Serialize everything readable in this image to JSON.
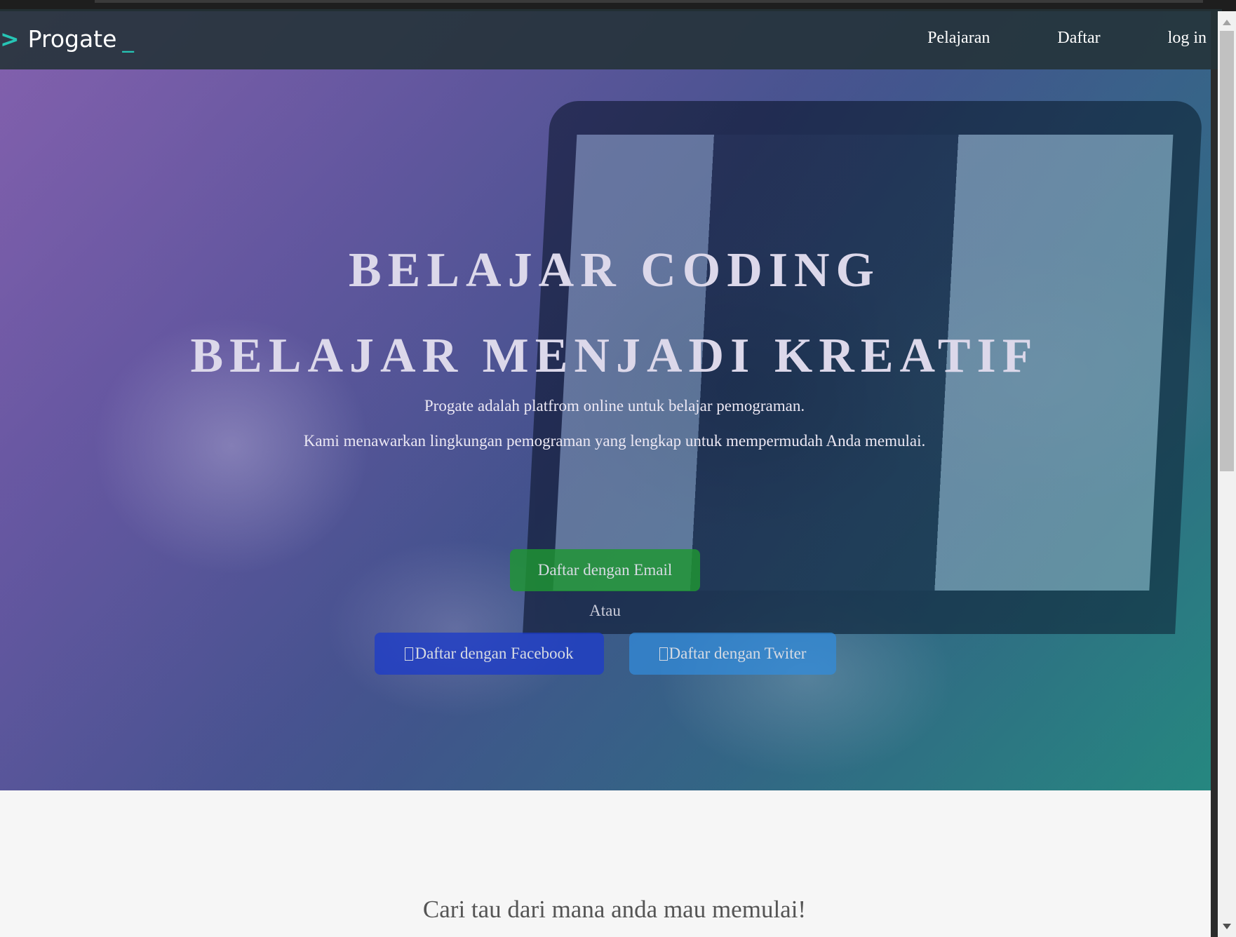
{
  "nav": {
    "brand": "Progate",
    "brand_prompt": ">",
    "brand_cursor": "_",
    "links": [
      "Pelajaran",
      "Daftar",
      "log in"
    ]
  },
  "hero": {
    "headline_1": "BELAJAR CODING",
    "headline_2": "BELAJAR MENJADI KREATIF",
    "subtitle_1": "Progate adalah platfrom online untuk belajar pemograman.",
    "subtitle_2": "Kami menawarkan lingkungan pemograman yang lengkap untuk mempermudah Anda memulai.",
    "email_button": "Daftar dengan Email",
    "or_text": "Atau",
    "facebook_button": "Daftar dengan Facebook",
    "twitter_button": "Daftar dengan Twiter"
  },
  "section": {
    "title": "Cari tau dari mana anda mau memulai!"
  },
  "colors": {
    "brand_accent": "#26c5b5",
    "email_button": "#1e9632",
    "facebook_button": "#1e3cc8",
    "twitter_button": "#328cdc",
    "navbar": "#233237"
  },
  "icons": {
    "facebook": "facebook-icon",
    "twitter": "twitter-icon"
  }
}
